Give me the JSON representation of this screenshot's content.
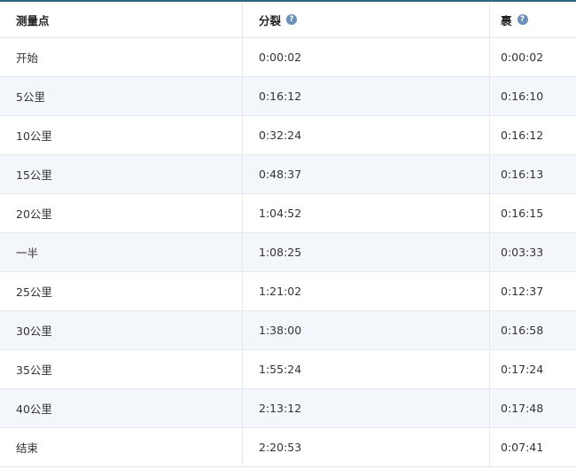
{
  "table": {
    "headers": {
      "checkpoint": "测量点",
      "split": "分裂",
      "lap": "裹",
      "help_glyph": "?"
    },
    "rows": [
      {
        "checkpoint": "开始",
        "split": "0:00:02",
        "lap": "0:00:02"
      },
      {
        "checkpoint": "5公里",
        "split": "0:16:12",
        "lap": "0:16:10"
      },
      {
        "checkpoint": "10公里",
        "split": "0:32:24",
        "lap": "0:16:12"
      },
      {
        "checkpoint": "15公里",
        "split": "0:48:37",
        "lap": "0:16:13"
      },
      {
        "checkpoint": "20公里",
        "split": "1:04:52",
        "lap": "0:16:15"
      },
      {
        "checkpoint": "一半",
        "split": "1:08:25",
        "lap": "0:03:33"
      },
      {
        "checkpoint": "25公里",
        "split": "1:21:02",
        "lap": "0:12:37"
      },
      {
        "checkpoint": "30公里",
        "split": "1:38:00",
        "lap": "0:16:58"
      },
      {
        "checkpoint": "35公里",
        "split": "1:55:24",
        "lap": "0:17:24"
      },
      {
        "checkpoint": "40公里",
        "split": "2:13:12",
        "lap": "0:17:48"
      },
      {
        "checkpoint": "结束",
        "split": "2:20:53",
        "lap": "0:07:41"
      }
    ]
  },
  "colors": {
    "header_border": "#2e6580",
    "row_alt": "#f3f7fb",
    "help_icon": "#6a8fb8"
  },
  "icons": {
    "help": "question-circle-icon"
  }
}
